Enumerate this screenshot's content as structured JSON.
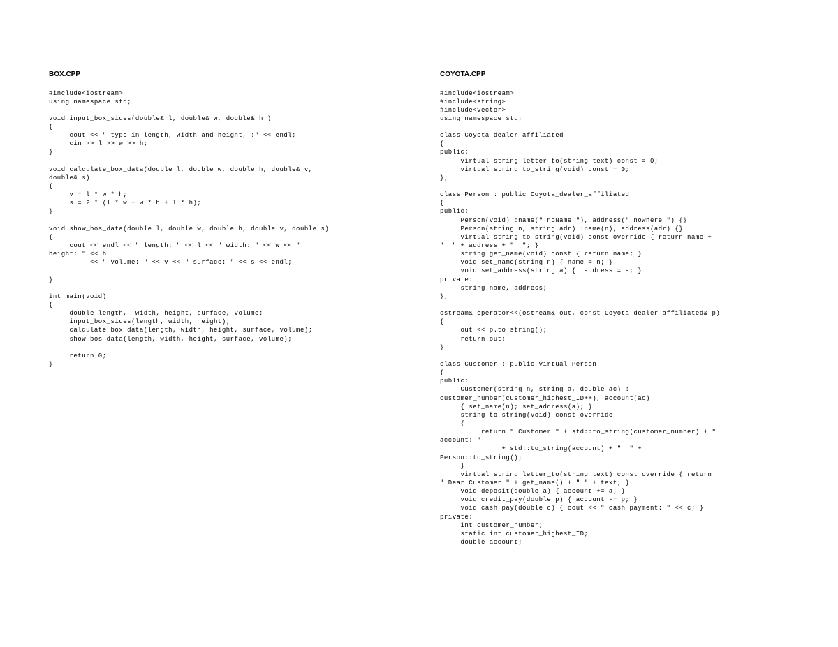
{
  "left": {
    "title": "BOX.CPP",
    "code": "#include<iostream>\nusing namespace std;\n\nvoid input_box_sides(double& l, double& w, double& h )\n{\n     cout << \" type in length, width and height, :\" << endl;\n     cin >> l >> w >> h;\n}\n\nvoid calculate_box_data(double l, double w, double h, double& v,\ndouble& s)\n{\n     v = l * w * h;\n     s = 2 * (l * w + w * h + l * h);\n}\n\nvoid show_bos_data(double l, double w, double h, double v, double s)\n{\n     cout << endl << \" length: \" << l << \" width: \" << w << \"\nheight: \" << h\n          << \" volume: \" << v << \" surface: \" << s << endl;\n\n}\n\nint main(void)\n{\n     double length,  width, height, surface, volume;\n     input_box_sides(length, width, height);\n     calculate_box_data(length, width, height, surface, volume);\n     show_bos_data(length, width, height, surface, volume);\n\n     return 0;\n}"
  },
  "right": {
    "title": "COYOTA.CPP",
    "code": "#include<iostream>\n#include<string>\n#include<vector>\nusing namespace std;\n\nclass Coyota_dealer_affiliated\n{\npublic:\n     virtual string letter_to(string text) const = 0;\n     virtual string to_string(void) const = 0;\n};\n\nclass Person : public Coyota_dealer_affiliated\n{\npublic:\n     Person(void) :name(\" noName \"), address(\" nowhere \") {}\n     Person(string n, string adr) :name(n), address(adr) {}\n     virtual string to_string(void) const override { return name +\n\"  \" + address + \"  \"; }\n     string get_name(void) const { return name; }\n     void set_name(string n) { name = n; }\n     void set_address(string a) {  address = a; }\nprivate:\n     string name, address;\n};\n\nostream& operator<<(ostream& out, const Coyota_dealer_affiliated& p)\n{\n     out << p.to_string();\n     return out;\n}\n\nclass Customer : public virtual Person\n{\npublic:\n     Customer(string n, string a, double ac) :\ncustomer_number(customer_highest_ID++), account(ac)\n     { set_name(n); set_address(a); }\n     string to_string(void) const override\n     {\n          return \" Customer \" + std::to_string(customer_number) + \"\naccount: \" \n               + std::to_string(account) + \"  \" +\nPerson::to_string();\n     }\n     virtual string letter_to(string text) const override { return\n\" Dear Customer \" + get_name() + \" \" + text; }\n     void deposit(double a) { account += a; }\n     void credit_pay(double p) { account -= p; }\n     void cash_pay(double c) { cout << \" cash payment: \" << c; }\nprivate:\n     int customer_number;\n     static int customer_highest_ID;\n     double account;"
  }
}
